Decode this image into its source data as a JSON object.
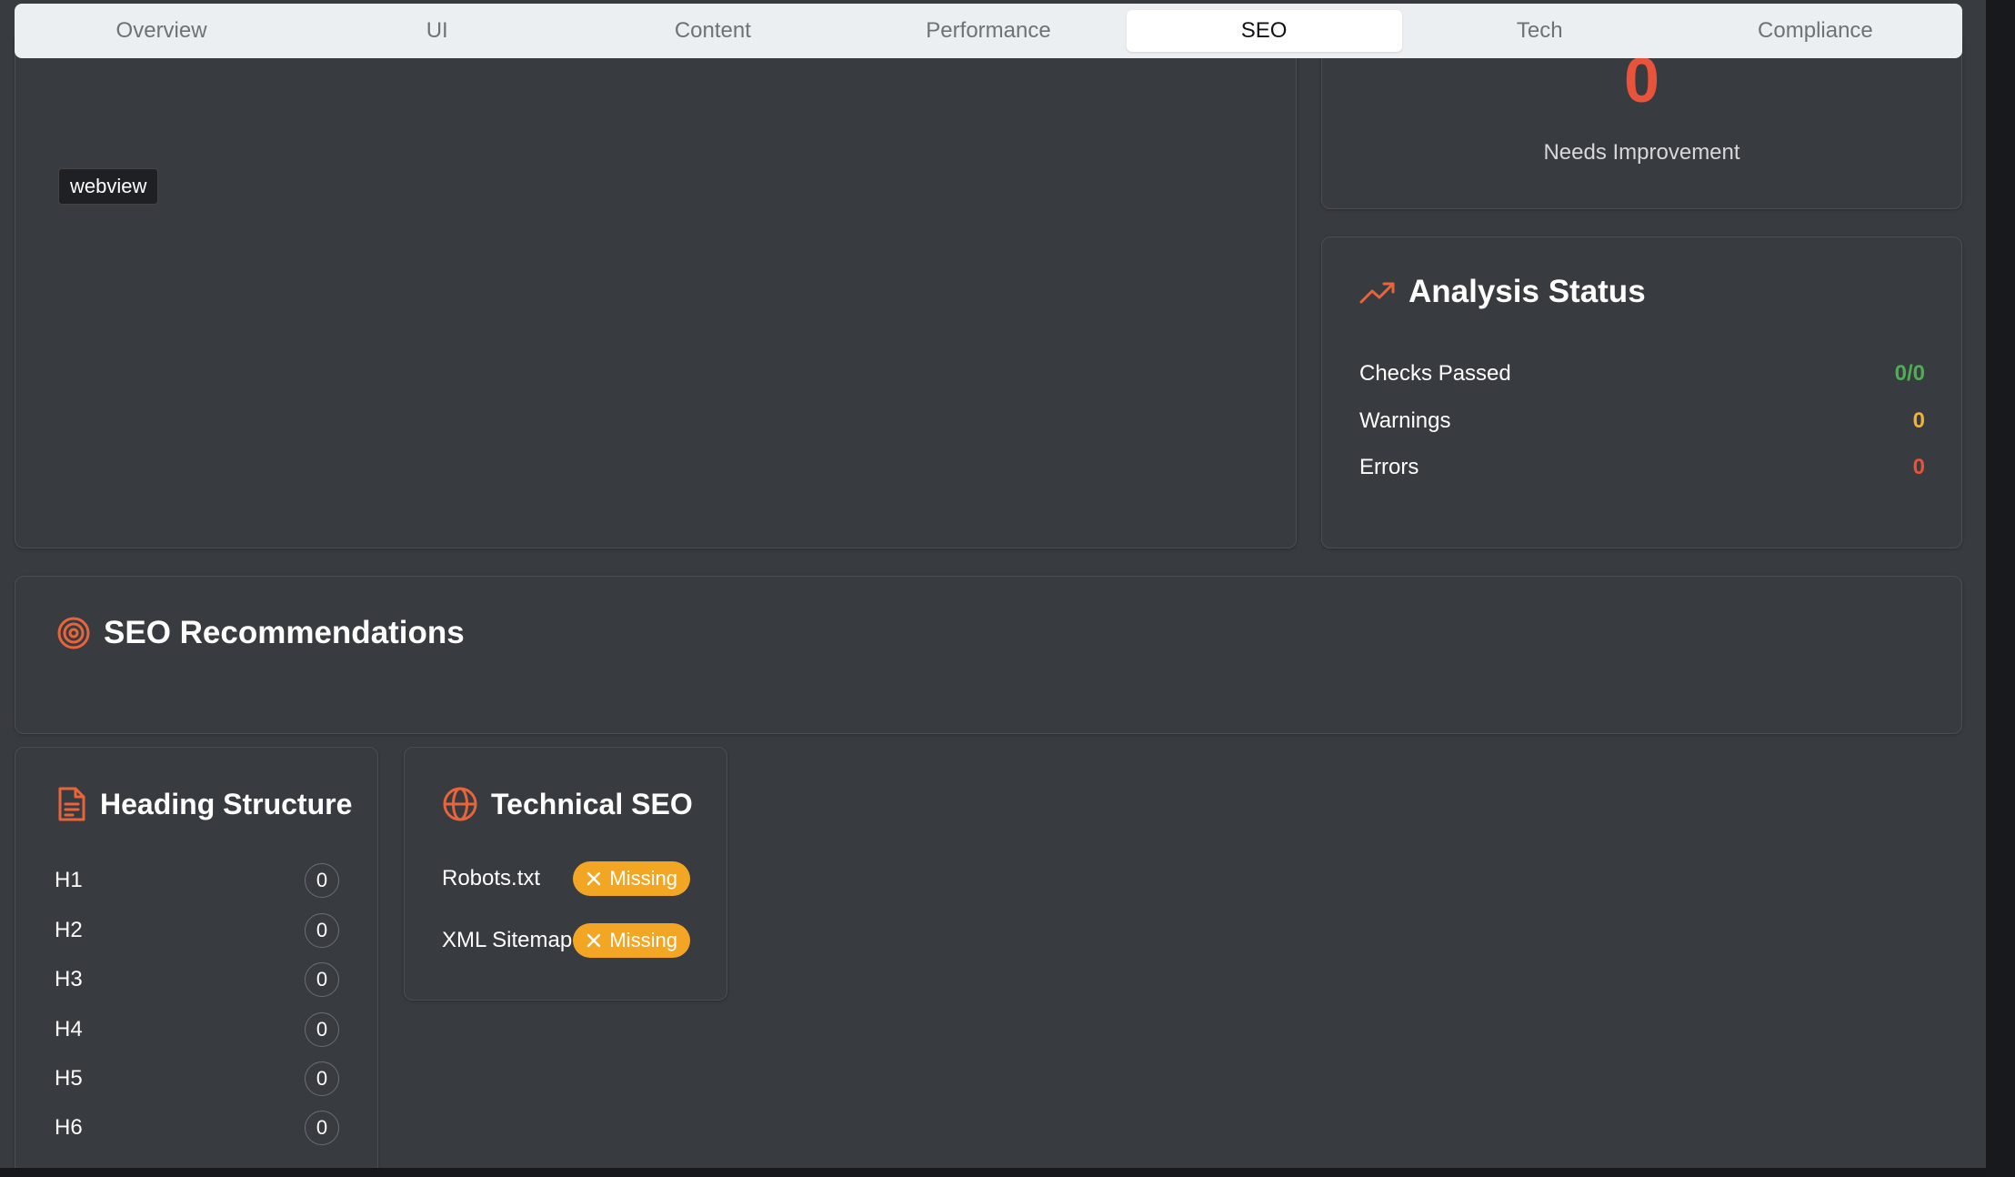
{
  "tabs": [
    {
      "label": "Overview",
      "active": false
    },
    {
      "label": "UI",
      "active": false
    },
    {
      "label": "Content",
      "active": false
    },
    {
      "label": "Performance",
      "active": false
    },
    {
      "label": "SEO",
      "active": true
    },
    {
      "label": "Tech",
      "active": false
    },
    {
      "label": "Compliance",
      "active": false
    }
  ],
  "preview": {
    "tag": "webview"
  },
  "score": {
    "value": "0",
    "label": "Needs Improvement"
  },
  "status": {
    "title": "Analysis Status",
    "icon": "trending-up-icon",
    "rows": [
      {
        "label": "Checks Passed",
        "value": "0/0",
        "color": "#4caf50"
      },
      {
        "label": "Warnings",
        "value": "0",
        "color": "#f2b233"
      },
      {
        "label": "Errors",
        "value": "0",
        "color": "#e8533b"
      }
    ]
  },
  "recommendations": {
    "title": "SEO Recommendations",
    "icon": "target-icon"
  },
  "headings": {
    "title": "Heading Structure",
    "icon": "file-text-icon",
    "rows": [
      {
        "label": "H1",
        "count": "0"
      },
      {
        "label": "H2",
        "count": "0"
      },
      {
        "label": "H3",
        "count": "0"
      },
      {
        "label": "H4",
        "count": "0"
      },
      {
        "label": "H5",
        "count": "0"
      },
      {
        "label": "H6",
        "count": "0"
      }
    ]
  },
  "technical": {
    "title": "Technical SEO",
    "icon": "globe-icon",
    "rows": [
      {
        "label": "Robots.txt",
        "status": "Missing"
      },
      {
        "label": "XML Sitemap",
        "status": "Missing"
      }
    ]
  },
  "colors": {
    "accent": "#e8653b",
    "warning": "#f2a623",
    "success": "#4caf50",
    "error": "#e8533b"
  }
}
